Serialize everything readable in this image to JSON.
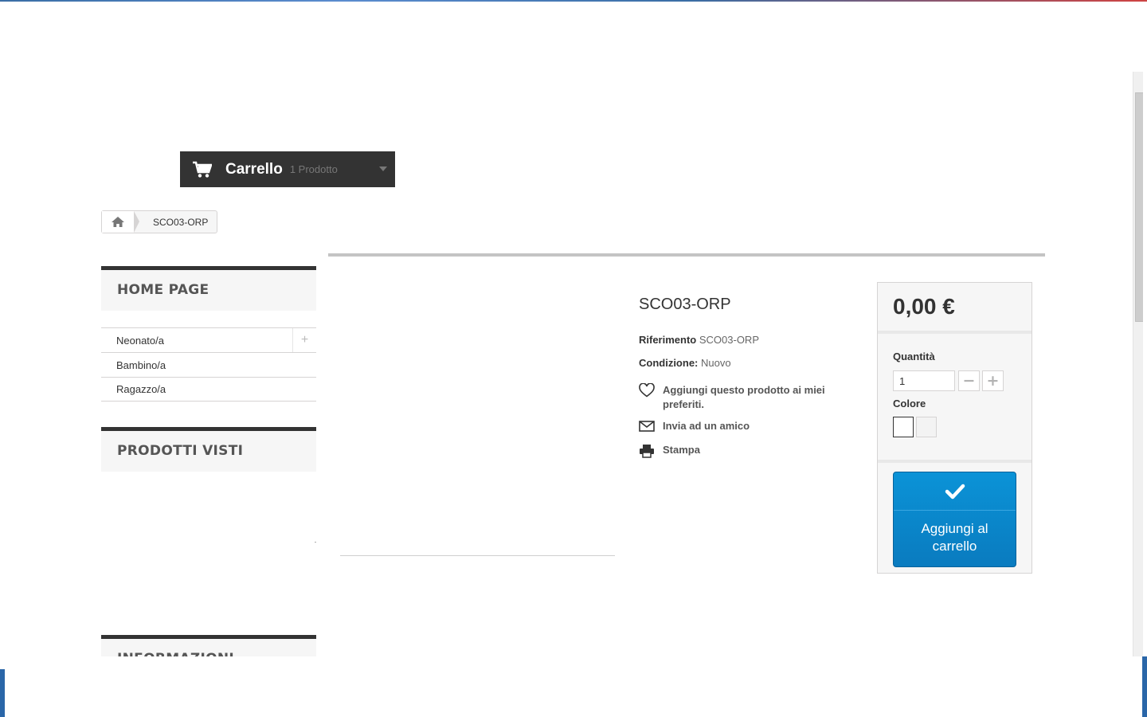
{
  "cart": {
    "label": "Carrello",
    "count_text": "1 Prodotto"
  },
  "breadcrumb": {
    "current": "SCO03-ORP"
  },
  "left_column": {
    "categories_title": "HOME PAGE",
    "categories": [
      {
        "label": "Neonato/a",
        "expandable": true,
        "expand_symbol": "+"
      },
      {
        "label": "Bambino/a",
        "expandable": false
      },
      {
        "label": "Ragazzo/a",
        "expandable": false
      }
    ],
    "viewed_title": "PRODOTTI VISTI",
    "info_title": "INFORMAZIONI"
  },
  "product": {
    "title": "SCO03-ORP",
    "reference_label": "Riferimento",
    "reference_value": "SCO03-ORP",
    "condition_label": "Condizione:",
    "condition_value": "Nuovo",
    "wishlist_text": "Aggiungi questo prodotto ai miei preferiti.",
    "send_friend_text": "Invia ad un amico",
    "print_text": "Stampa"
  },
  "buy_box": {
    "price": "0,00 €",
    "quantity_label": "Quantità",
    "quantity_value": "1",
    "minus_symbol": "−",
    "plus_symbol": "+",
    "color_label": "Colore",
    "add_to_cart_label": "Aggiungi al carrello",
    "primary_color": "#0a7bbf"
  },
  "icons": {
    "cart": "cart-icon",
    "home": "home-icon",
    "heart": "heart-icon",
    "envelope": "envelope-icon",
    "print": "print-icon",
    "check": "check-icon",
    "caret": "caret-down-icon"
  }
}
